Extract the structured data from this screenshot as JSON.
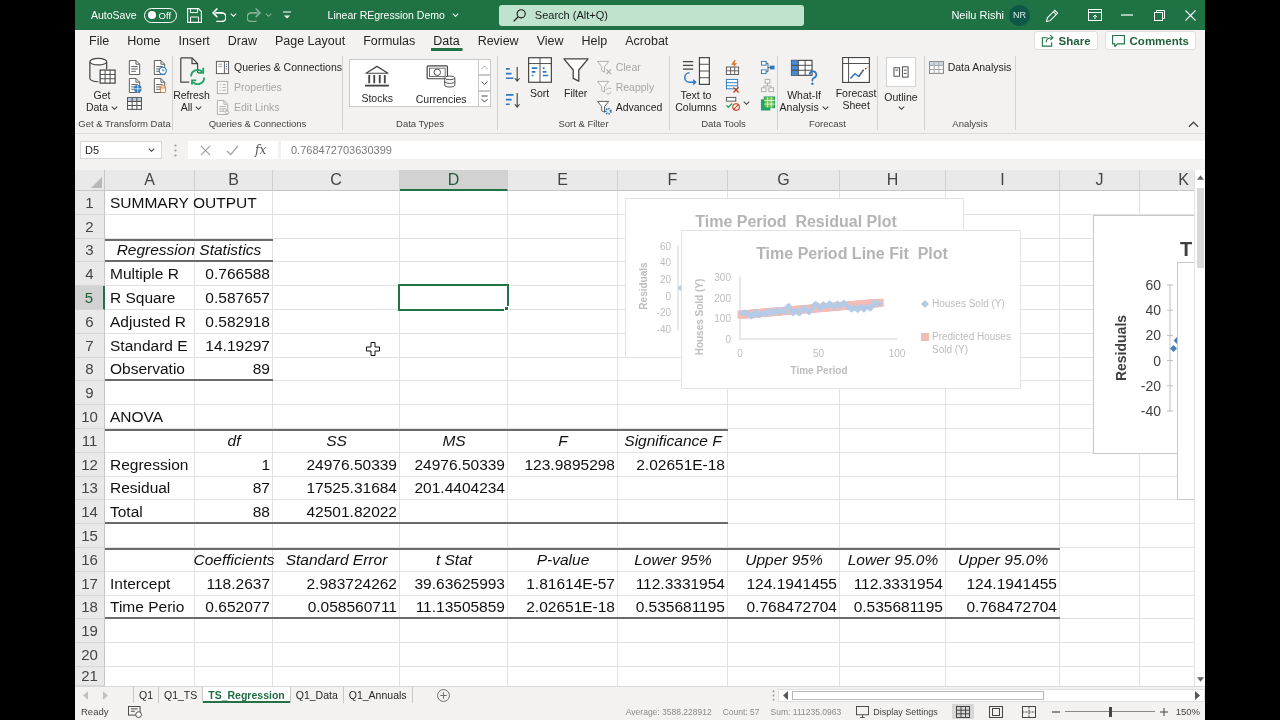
{
  "title_bar": {
    "autosave_label": "AutoSave",
    "autosave": {
      "on": false,
      "label": "Off"
    },
    "quick_access": [
      {
        "kind": "save",
        "disabled": false,
        "dropdown": false
      },
      {
        "kind": "undo",
        "disabled": false,
        "dropdown": true
      },
      {
        "kind": "redo",
        "disabled": true,
        "dropdown": true
      },
      {
        "kind": "customize",
        "disabled": false,
        "dropdown": false
      }
    ],
    "document_title": "Linear REgression Demo",
    "search": {
      "placeholder": "Search (Alt+Q)"
    },
    "user_name": "Neilu Rishi",
    "user_initials": "NR"
  },
  "menu_tabs": [
    {
      "label": "File",
      "selected": false
    },
    {
      "label": "Home",
      "selected": false
    },
    {
      "label": "Insert",
      "selected": false
    },
    {
      "label": "Draw",
      "selected": false
    },
    {
      "label": "Page Layout",
      "selected": false
    },
    {
      "label": "Formulas",
      "selected": false
    },
    {
      "label": "Data",
      "selected": true
    },
    {
      "label": "Review",
      "selected": false
    },
    {
      "label": "View",
      "selected": false
    },
    {
      "label": "Help",
      "selected": false
    },
    {
      "label": "Acrobat",
      "selected": false
    }
  ],
  "share_button": "Share",
  "comments_button": "Comments",
  "ribbon": [
    {
      "label": "Get & Transform Data",
      "controls": [
        {
          "kind": "large",
          "label": "Get Data",
          "dropdown": true,
          "disabled": false
        },
        {
          "kind": "icon",
          "dropdown": false,
          "disabled": false
        },
        {
          "kind": "icon",
          "dropdown": false,
          "disabled": false
        },
        {
          "kind": "icon",
          "dropdown": false,
          "disabled": false
        },
        {
          "kind": "icon",
          "dropdown": false,
          "disabled": false
        },
        {
          "kind": "icon",
          "dropdown": false,
          "disabled": false
        }
      ]
    },
    {
      "label": "Queries & Connections",
      "controls": [
        {
          "kind": "large",
          "label": "Refresh All",
          "dropdown": true,
          "disabled": false
        },
        {
          "kind": "small",
          "label": "Queries & Connections",
          "dropdown": false,
          "disabled": false
        },
        {
          "kind": "small",
          "label": "Properties",
          "dropdown": false,
          "disabled": true
        },
        {
          "kind": "small",
          "label": "Edit Links",
          "dropdown": false,
          "disabled": true
        }
      ]
    },
    {
      "label": "Data Types",
      "controls": [
        {
          "kind": "gallery",
          "disabled": false,
          "options": [
            {
              "label": "Stocks"
            },
            {
              "label": "Currencies"
            }
          ]
        }
      ]
    },
    {
      "label": "Sort & Filter",
      "controls": [
        {
          "kind": "icon",
          "dropdown": false,
          "disabled": false
        },
        {
          "kind": "icon",
          "dropdown": false,
          "disabled": false
        },
        {
          "kind": "large",
          "label": "Sort",
          "dropdown": false,
          "disabled": false
        },
        {
          "kind": "large",
          "label": "Filter",
          "dropdown": false,
          "disabled": false
        },
        {
          "kind": "small",
          "label": "Clear",
          "dropdown": false,
          "disabled": true
        },
        {
          "kind": "small",
          "label": "Reapply",
          "dropdown": false,
          "disabled": true
        },
        {
          "kind": "small",
          "label": "Advanced",
          "dropdown": false,
          "disabled": false
        }
      ]
    },
    {
      "label": "Data Tools",
      "controls": [
        {
          "kind": "large",
          "label": "Text to Columns",
          "dropdown": false,
          "disabled": false
        },
        {
          "kind": "icon",
          "dropdown": false,
          "disabled": false
        },
        {
          "kind": "icon",
          "dropdown": false,
          "disabled": false
        },
        {
          "kind": "icon",
          "dropdown": true,
          "disabled": false
        },
        {
          "kind": "icon",
          "dropdown": false,
          "disabled": false
        },
        {
          "kind": "icon",
          "dropdown": false,
          "disabled": true
        },
        {
          "kind": "icon",
          "dropdown": false,
          "disabled": false
        }
      ]
    },
    {
      "label": "Forecast",
      "controls": [
        {
          "kind": "large",
          "label": "What-If Analysis",
          "dropdown": true,
          "disabled": false
        },
        {
          "kind": "large",
          "label": "Forecast Sheet",
          "dropdown": false,
          "disabled": false
        }
      ]
    },
    {
      "controls": [
        {
          "kind": "large",
          "label": "Outline",
          "dropdown": true,
          "disabled": false
        }
      ]
    },
    {
      "label": "Analysis",
      "controls": [
        {
          "kind": "small",
          "label": "Data Analysis",
          "dropdown": false,
          "disabled": false
        }
      ]
    }
  ],
  "formula_bar": {
    "name_box": "D5",
    "function_label": "fx",
    "formula": "0.768472703630399"
  },
  "sheet": {
    "columns": [
      {
        "label": "A",
        "selected": false
      },
      {
        "label": "B",
        "selected": false
      },
      {
        "label": "C",
        "selected": false
      },
      {
        "label": "D",
        "selected": true
      },
      {
        "label": "E",
        "selected": false
      },
      {
        "label": "F",
        "selected": false
      },
      {
        "label": "G",
        "selected": false
      },
      {
        "label": "H",
        "selected": false
      },
      {
        "label": "I",
        "selected": false
      },
      {
        "label": "J",
        "selected": false
      },
      {
        "label": "K",
        "selected": false
      }
    ],
    "rows": [
      {
        "number": "1",
        "selected": false,
        "cells": [
          {
            "text": "SUMMARY OUTPUT",
            "kind": "text",
            "border_top": false,
            "border_bottom": false
          }
        ]
      },
      {
        "number": "2",
        "selected": false
      },
      {
        "number": "3",
        "selected": false,
        "cells": [
          {
            "text": "Regression Statistics",
            "kind": "caption",
            "border_top": true,
            "border_bottom": true
          }
        ]
      },
      {
        "number": "4",
        "selected": false,
        "cells": [
          {
            "text": "Multiple R",
            "kind": "text",
            "border_top": false,
            "border_bottom": false
          },
          {
            "text": "0.766588",
            "kind": "number",
            "border_top": false,
            "border_bottom": false
          }
        ]
      },
      {
        "number": "5",
        "selected": true,
        "cells": [
          {
            "text": "R Square",
            "kind": "text",
            "border_top": false,
            "border_bottom": false
          },
          {
            "text": "0.587657",
            "kind": "number",
            "border_top": false,
            "border_bottom": false
          }
        ]
      },
      {
        "number": "6",
        "selected": false,
        "cells": [
          {
            "text": "Adjusted R",
            "kind": "text",
            "border_top": false,
            "border_bottom": false
          },
          {
            "text": "0.582918",
            "kind": "number",
            "border_top": false,
            "border_bottom": false
          }
        ]
      },
      {
        "number": "7",
        "selected": false,
        "cells": [
          {
            "text": "Standard E",
            "kind": "text",
            "border_top": false,
            "border_bottom": false
          },
          {
            "text": "14.19297",
            "kind": "number",
            "border_top": false,
            "border_bottom": false
          }
        ]
      },
      {
        "number": "8",
        "selected": false,
        "cells": [
          {
            "text": "Observatio",
            "kind": "text",
            "border_top": false,
            "border_bottom": true
          },
          {
            "text": "89",
            "kind": "number",
            "border_top": false,
            "border_bottom": true
          }
        ]
      },
      {
        "number": "9",
        "selected": false
      },
      {
        "number": "10",
        "selected": false,
        "cells": [
          {
            "text": "ANOVA",
            "kind": "text",
            "border_top": false,
            "border_bottom": false
          }
        ]
      },
      {
        "number": "11",
        "selected": false,
        "cells": [
          {
            "border_top": true,
            "border_bottom": false
          },
          {
            "text": "df",
            "kind": "header",
            "border_top": true,
            "border_bottom": false
          },
          {
            "text": "SS",
            "kind": "header",
            "border_top": true,
            "border_bottom": false
          },
          {
            "text": "MS",
            "kind": "header",
            "border_top": true,
            "border_bottom": false
          },
          {
            "text": "F",
            "kind": "header",
            "border_top": true,
            "border_bottom": false
          },
          {
            "text": "Significance F",
            "kind": "header",
            "border_top": true,
            "border_bottom": false
          }
        ]
      },
      {
        "number": "12",
        "selected": false,
        "cells": [
          {
            "text": "Regression",
            "kind": "text",
            "border_top": false,
            "border_bottom": false
          },
          {
            "text": "1",
            "kind": "number",
            "border_top": false,
            "border_bottom": false
          },
          {
            "text": "24976.50339",
            "kind": "number",
            "border_top": false,
            "border_bottom": false
          },
          {
            "text": "24976.50339",
            "kind": "number",
            "border_top": false,
            "border_bottom": false
          },
          {
            "text": "123.9895298",
            "kind": "number",
            "border_top": false,
            "border_bottom": false
          },
          {
            "text": "2.02651E-18",
            "kind": "number",
            "border_top": false,
            "border_bottom": false
          }
        ]
      },
      {
        "number": "13",
        "selected": false,
        "cells": [
          {
            "text": "Residual",
            "kind": "text",
            "border_top": false,
            "border_bottom": false
          },
          {
            "text": "87",
            "kind": "number",
            "border_top": false,
            "border_bottom": false
          },
          {
            "text": "17525.31684",
            "kind": "number",
            "border_top": false,
            "border_bottom": false
          },
          {
            "text": "201.4404234",
            "kind": "number",
            "border_top": false,
            "border_bottom": false
          }
        ]
      },
      {
        "number": "14",
        "selected": false,
        "cells": [
          {
            "text": "Total",
            "kind": "text",
            "border_top": false,
            "border_bottom": true
          },
          {
            "text": "88",
            "kind": "number",
            "border_top": false,
            "border_bottom": true
          },
          {
            "text": "42501.82022",
            "kind": "number",
            "border_top": false,
            "border_bottom": true
          },
          {
            "border_top": false,
            "border_bottom": true
          },
          {
            "border_top": false,
            "border_bottom": true
          },
          {
            "border_top": false,
            "border_bottom": true
          }
        ]
      },
      {
        "number": "15",
        "selected": false
      },
      {
        "number": "16",
        "selected": false,
        "cells": [
          {
            "border_top": true,
            "border_bottom": false
          },
          {
            "text": "Coefficients",
            "kind": "header",
            "border_top": true,
            "border_bottom": false
          },
          {
            "text": "Standard Error",
            "kind": "header",
            "border_top": true,
            "border_bottom": false
          },
          {
            "text": "t Stat",
            "kind": "header",
            "border_top": true,
            "border_bottom": false
          },
          {
            "text": "P-value",
            "kind": "header",
            "border_top": true,
            "border_bottom": false
          },
          {
            "text": "Lower 95%",
            "kind": "header",
            "border_top": true,
            "border_bottom": false
          },
          {
            "text": "Upper 95%",
            "kind": "header",
            "border_top": true,
            "border_bottom": false
          },
          {
            "text": "Lower 95.0%",
            "kind": "header",
            "border_top": true,
            "border_bottom": false
          },
          {
            "text": "Upper 95.0%",
            "kind": "header",
            "border_top": true,
            "border_bottom": false
          }
        ]
      },
      {
        "number": "17",
        "selected": false,
        "cells": [
          {
            "text": "Intercept",
            "kind": "text",
            "border_top": false,
            "border_bottom": false
          },
          {
            "text": "118.2637",
            "kind": "number",
            "border_top": false,
            "border_bottom": false
          },
          {
            "text": "2.983724262",
            "kind": "number",
            "border_top": false,
            "border_bottom": false
          },
          {
            "text": "39.63625993",
            "kind": "number",
            "border_top": false,
            "border_bottom": false
          },
          {
            "text": "1.81614E-57",
            "kind": "number",
            "border_top": false,
            "border_bottom": false
          },
          {
            "text": "112.3331954",
            "kind": "number",
            "border_top": false,
            "border_bottom": false
          },
          {
            "text": "124.1941455",
            "kind": "number",
            "border_top": false,
            "border_bottom": false
          },
          {
            "text": "112.3331954",
            "kind": "number",
            "border_top": false,
            "border_bottom": false
          },
          {
            "text": "124.1941455",
            "kind": "number",
            "border_top": false,
            "border_bottom": false
          }
        ]
      },
      {
        "number": "18",
        "selected": false,
        "cells": [
          {
            "text": "Time Perio",
            "kind": "text",
            "border_top": false,
            "border_bottom": true
          },
          {
            "text": "0.652077",
            "kind": "number",
            "border_top": false,
            "border_bottom": true
          },
          {
            "text": "0.058560711",
            "kind": "number",
            "border_top": false,
            "border_bottom": true
          },
          {
            "text": "11.13505859",
            "kind": "number",
            "border_top": false,
            "border_bottom": true
          },
          {
            "text": "2.02651E-18",
            "kind": "number",
            "border_top": false,
            "border_bottom": true
          },
          {
            "text": "0.535681195",
            "kind": "number",
            "border_top": false,
            "border_bottom": true
          },
          {
            "text": "0.768472704",
            "kind": "number",
            "border_top": false,
            "border_bottom": true
          },
          {
            "text": "0.535681195",
            "kind": "number",
            "border_top": false,
            "border_bottom": true
          },
          {
            "text": "0.768472704",
            "kind": "number",
            "border_top": false,
            "border_bottom": true
          }
        ]
      },
      {
        "number": "19",
        "selected": false
      },
      {
        "number": "20",
        "selected": false
      },
      {
        "number": "21",
        "selected": false
      }
    ]
  },
  "charts": [
    {
      "kind": "scatter_picture",
      "faded": true,
      "title": "Time Period  Residual Plot",
      "ylabel": "Residuals",
      "y_tick_labels": [
        "60",
        "40",
        "20",
        "0",
        "-20",
        "-40"
      ]
    },
    {
      "kind": "scatter_picture",
      "faded": true,
      "title": "Time Period Line Fit  Plot",
      "xlabel": "Time Period",
      "ylabel": "Houses Sold (Y)",
      "x_tick_labels": [
        "0",
        "50",
        "100"
      ],
      "y_tick_labels": [
        "300",
        "200",
        "100",
        "0"
      ],
      "legend": [
        {
          "label": "Houses Sold (Y)",
          "color": "#b4cbe8"
        },
        {
          "label": "Predicted Houses Sold (Y)",
          "color": "#f3bdb6"
        }
      ]
    },
    {
      "kind": "scatter_picture",
      "faded": false,
      "title": "T",
      "ylabel": "Residuals",
      "y_tick_labels": [
        "60",
        "40",
        "20",
        "0",
        "-20",
        "-40"
      ]
    },
    {
      "kind": "blank",
      "faded": false
    }
  ],
  "sheet_tabs": [
    {
      "label": "Q1",
      "selected": false
    },
    {
      "label": "Q1_TS",
      "selected": false
    },
    {
      "label": "TS_Regression",
      "selected": true
    },
    {
      "label": "Q1_Data",
      "selected": false
    },
    {
      "label": "Q1_Annuals",
      "selected": false
    }
  ],
  "status_bar": {
    "mode": "Ready",
    "stats": [
      "Average: 3588.228912",
      "Count: 57",
      "Sum: 111235.0963"
    ],
    "display_settings": "Display Settings",
    "views": [
      {
        "kind": "normal",
        "selected": true
      },
      {
        "kind": "page_layout",
        "selected": false
      },
      {
        "kind": "page_break",
        "selected": false
      }
    ],
    "zoom": {
      "level": 0.5,
      "label": "150%"
    }
  }
}
